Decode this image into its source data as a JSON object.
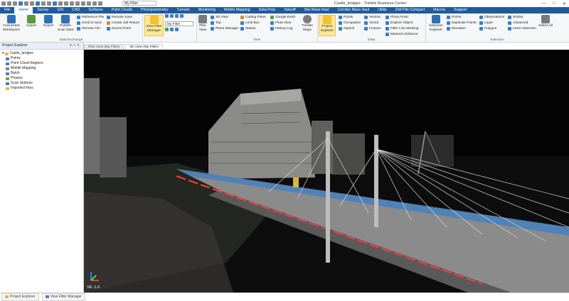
{
  "app": {
    "window_title": "Castle_bridges - Trimble Business Center",
    "quick_filter": "My Filter"
  },
  "ribbon_tabs": [
    "File",
    "Home",
    "Survey",
    "GIS",
    "CAD",
    "Surfaces",
    "Point Clouds",
    "Photogrammetry",
    "Tunnels",
    "Monitoring",
    "Mobile Mapping",
    "Data Prep",
    "Takeoff",
    "Site Mass Haul",
    "Corridor Mass Haul",
    "Utility",
    "Drill Pile Compact",
    "Macros",
    "Support"
  ],
  "ribbon": {
    "data_exchange": {
      "label": "Data Exchange",
      "connected_workspace": "Connected Workspace",
      "import": "Import",
      "export": "Export",
      "publish_scan_data": "Publish Scan Data",
      "reference_file": "Reference File",
      "send_to_sync": "Send to Sync",
      "remote_file": "Remote File",
      "remote_save": "Remote Save",
      "create_job_report": "Create Job Report",
      "device_pane": "Device Pane"
    },
    "view_filter_manager": "View Filter Manager",
    "filter_dropdown": "My Filter",
    "view": {
      "label": "View",
      "plan_view": "Plan View",
      "view_3d": "3D View",
      "top": "Top",
      "plane_manager": "Plane Manager",
      "cutting_plane": "Cutting Plane",
      "limit_box": "Limit Box",
      "station": "Station",
      "google_earth": "Google Earth",
      "float_view": "Float View",
      "history_log": "History Log",
      "trimble_maps": "Trimble Maps"
    },
    "data": {
      "label": "Data",
      "project_explorer": "Project Explorer",
      "points": "Points",
      "occupation": "Occupation",
      "optical": "Optical",
      "vectors": "Vectors",
      "vector": "Vector",
      "feature": "Feature",
      "photo_point": "Photo Point",
      "explore_object": "Explore Object",
      "filter_line_marking": "Filter Line Marking",
      "measure_distance": "Measure Distance"
    },
    "selection": {
      "label": "Selection",
      "selection_explorer": "Selection Explorer",
      "points": "Points",
      "duplicate_points": "Duplicate Points",
      "elevation": "Elevation",
      "observations": "Observations",
      "layer": "Layer",
      "polygon": "Polygon",
      "similar": "Similar",
      "advanced": "Advanced",
      "invert_selection": "Invert Selection",
      "select_all": "Select All"
    }
  },
  "project_explorer": {
    "title": "Project Explorer",
    "tree": [
      "Castle_bridges",
      "Points",
      "Point Cloud Regions",
      "Mobile Mapping",
      "Batch",
      "Phases",
      "Scan Stations",
      "Imported Files"
    ]
  },
  "view_tabs": [
    "Plan View (My Filter)",
    "3D View (My Filter)"
  ],
  "viewport": {
    "ve_label": "VE: 1.0"
  },
  "status_tabs": [
    "Project Explorer",
    "View Filter Manager"
  ]
}
